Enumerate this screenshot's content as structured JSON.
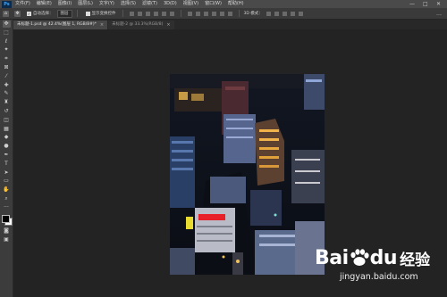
{
  "menubar": {
    "logo": "Ps",
    "items": [
      "文件(F)",
      "编辑(E)",
      "图像(I)",
      "图层(L)",
      "文字(Y)",
      "选择(S)",
      "滤镜(T)",
      "3D(D)",
      "视图(V)",
      "窗口(W)",
      "帮助(H)"
    ],
    "minimize": "—",
    "maximize": "□",
    "close": "✕"
  },
  "options": {
    "auto_select_label": "自动选择：",
    "auto_select_value": "图层",
    "transform_label": "显示变换控件",
    "mode_label": "3D 模式：",
    "more": "…"
  },
  "tabs": [
    {
      "label": "未标题-1.psd @ 42.4%(图层 1, RGB/8#)*",
      "close": "×",
      "active": true
    },
    {
      "label": "未标题-2 @ 33.3%(RGB/8)",
      "close": "×",
      "active": false
    }
  ],
  "tools": [
    {
      "name": "move-tool-icon",
      "glyph": "✥"
    },
    {
      "name": "marquee-tool-icon",
      "glyph": "⬚"
    },
    {
      "name": "lasso-tool-icon",
      "glyph": "ℓ"
    },
    {
      "name": "magic-wand-tool-icon",
      "glyph": "✦"
    },
    {
      "name": "crop-tool-icon",
      "glyph": "⌗"
    },
    {
      "name": "frame-tool-icon",
      "glyph": "⊠"
    },
    {
      "name": "eyedropper-tool-icon",
      "glyph": "⁄"
    },
    {
      "name": "healing-brush-tool-icon",
      "glyph": "✚"
    },
    {
      "name": "brush-tool-icon",
      "glyph": "✎"
    },
    {
      "name": "clone-stamp-tool-icon",
      "glyph": "♜"
    },
    {
      "name": "history-brush-tool-icon",
      "glyph": "↺"
    },
    {
      "name": "eraser-tool-icon",
      "glyph": "◫"
    },
    {
      "name": "gradient-tool-icon",
      "glyph": "▦"
    },
    {
      "name": "blur-tool-icon",
      "glyph": "◆"
    },
    {
      "name": "dodge-tool-icon",
      "glyph": "●"
    },
    {
      "name": "pen-tool-icon",
      "glyph": "✒"
    },
    {
      "name": "type-tool-icon",
      "glyph": "T"
    },
    {
      "name": "path-selection-tool-icon",
      "glyph": "➤"
    },
    {
      "name": "rectangle-tool-icon",
      "glyph": "▭"
    },
    {
      "name": "hand-tool-icon",
      "glyph": "✋"
    },
    {
      "name": "zoom-tool-icon",
      "glyph": "⌕"
    },
    {
      "name": "more-tools-icon",
      "glyph": "···"
    }
  ],
  "toolbar_bottom": [
    {
      "name": "quick-mask-icon",
      "glyph": "◙"
    },
    {
      "name": "screen-mode-icon",
      "glyph": "▣"
    }
  ],
  "watermark": {
    "bai": "Bai",
    "du": "du",
    "cn": "经验",
    "url": "jingyan.baidu.com"
  },
  "colors": {
    "accent": "#31a8ff",
    "neon_red": "#e8202a",
    "neon_yellow": "#e8dc30",
    "window_glow": "#f4c35a",
    "paw_blue": "#ffffff"
  }
}
